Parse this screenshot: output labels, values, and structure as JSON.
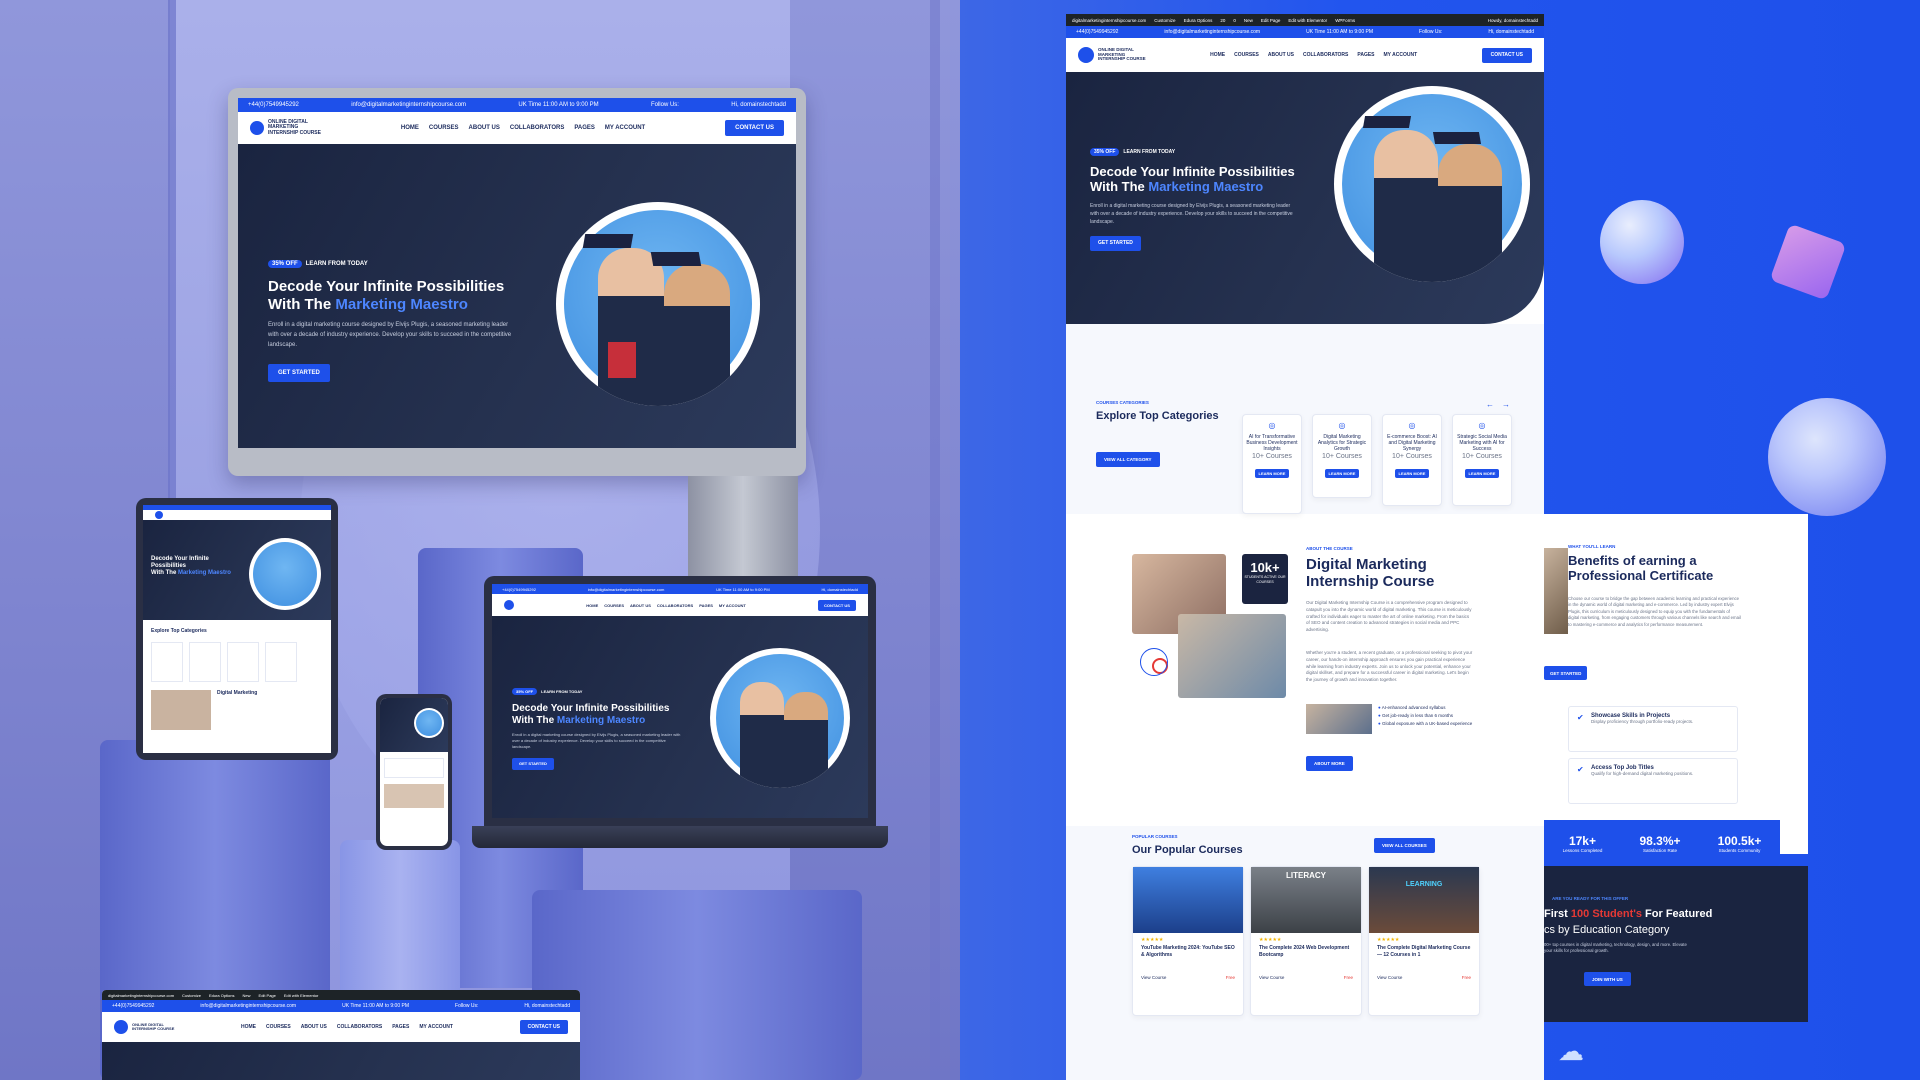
{
  "site": {
    "phone": "+44(0)7549945292",
    "email": "info@digitalmarketinginternshipcourse.com",
    "uk_time": "UK Time 11:00 AM to 9:00 PM",
    "follow_us": "Follow Us:",
    "greeting": "Hi, domainstechtadd",
    "logo_line1": "ONLINE DIGITAL",
    "logo_line2": "MARKETING",
    "logo_line3": "INTERNSHIP COURSE",
    "nav": [
      "HOME",
      "COURSES",
      "ABOUT US",
      "COLLABORATORS",
      "PAGES",
      "MY ACCOUNT"
    ],
    "contact_btn": "CONTACT US",
    "admin_bar": [
      "digitalmarketinginternshipcourse.com",
      "Customize",
      "Edura Options",
      "20",
      "0",
      "New",
      "Edit Page",
      "Edit with Elementor",
      "WPForms"
    ],
    "admin_howdy": "Howdy, domainstechtadd"
  },
  "hero": {
    "badge_off": "35% OFF",
    "badge_text": "LEARN FROM TODAY",
    "title_line1": "Decode Your Infinite Possibilities",
    "title_line2_plain": "With The ",
    "title_line2_accent": "Marketing Maestro",
    "desc": "Enroll in a digital marketing course designed by Elvijs Plugis, a seasoned marketing leader with over a decade of industry experience. Develop your skills to succeed in the competitive landscape.",
    "cta": "GET STARTED"
  },
  "categories": {
    "eyebrow": "COURSES CATEGORIES",
    "title": "Explore Top Categories",
    "view_all": "VIEW ALL CATEGORY",
    "items": [
      {
        "name": "AI for Transformative Business Development Insights",
        "count": "10+ Courses",
        "btn": "LEARN MORE"
      },
      {
        "name": "Digital Marketing Analytics for Strategic Growth",
        "count": "10+ Courses",
        "btn": "LEARN MORE"
      },
      {
        "name": "E-commerce Boost: AI and Digital Marketing Synergy",
        "count": "10+ Courses",
        "btn": "LEARN MORE"
      },
      {
        "name": "Strategic Social Media Marketing with AI for Success",
        "count": "10+ Courses",
        "btn": "LEARN MORE"
      }
    ]
  },
  "about": {
    "eyebrow": "ABOUT THE COURSE",
    "title_line1": "Digital Marketing",
    "title_line2": "Internship Course",
    "stat_num": "10k+",
    "stat_label": "STUDENTS ACTIVE OUR COURSES",
    "para1": "Our Digital Marketing Internship Course is a comprehensive program designed to catapult you into the dynamic world of digital marketing. This course is meticulously crafted for individuals eager to master the art of online marketing. From the basics of SEO and content creation to advanced strategies in social media and PPC advertising.",
    "para2": "Whether you're a student, a recent graduate, or a professional seeking to pivot your career, our hands-on internship approach ensures you gain practical experience while learning from industry experts. Join us to unlock your potential, enhance your digital skillset, and prepare for a successful career in digital marketing. Let's begin the journey of growth and innovation together.",
    "bullets": [
      "AI-enhanced advanced syllabus",
      "Get job-ready in less than 6 months",
      "Global exposure with a UK-based experience"
    ],
    "btn": "ABOUT MORE"
  },
  "benefits": {
    "eyebrow": "WHAT YOU'LL LEARN",
    "title_line1": "Benefits of earning a",
    "title_line2": "Professional Certificate",
    "desc": "Choose our course to bridge the gap between academic learning and practical experience in the dynamic world of digital marketing and e-commerce. Led by industry expert Elvijs Plugis, this curriculum is meticulously designed to equip you with the fundamentals of digital marketing, from engaging customers through various channels like search and email to mastering e-commerce and analytics for performance measurement.",
    "items": [
      {
        "title": "Showcase Skills in Projects",
        "desc": "Display proficiency through portfolio-ready projects."
      },
      {
        "title": "Access Top Job Titles",
        "desc": "Qualify for high-demand digital marketing positions."
      }
    ],
    "partial_btn": "GET STARTED"
  },
  "stats": [
    {
      "num": "17k+",
      "label": "Lessons Completed"
    },
    {
      "num": "98.3%+",
      "label": "Satisfaction Rate"
    },
    {
      "num": "100.5k+",
      "label": "Students Community"
    }
  ],
  "popular": {
    "eyebrow": "POPULAR COURSES",
    "title": "Our Popular Courses",
    "view_all": "VIEW ALL COURSES",
    "courses": [
      {
        "title": "YouTube Marketing 2024: YouTube SEO & Algorithms",
        "link": "View Course",
        "price": "Free",
        "img_label": ""
      },
      {
        "title": "The Complete 2024 Web Development Bootcamp",
        "link": "View Course",
        "price": "Free",
        "img_label": "LITERACY"
      },
      {
        "title": "The Complete Digital Marketing Course — 12 Courses in 1",
        "link": "View Course",
        "price": "Free",
        "img_label": "LEARNING"
      }
    ]
  },
  "cta_dark": {
    "eyebrow": "ARE YOU READY FOR THIS OFFER",
    "title_pre": "First ",
    "title_accent": "100 Student's",
    "title_post": " For Featured",
    "subtitle": "cs by Education Category",
    "desc": "00+ top courses in digital marketing, technology, design, and more. Elevate your skills for professional growth.",
    "btn": "JOIN WITH US"
  },
  "colors": {
    "brand": "#1e50ea",
    "dark": "#1a2440",
    "accent_red": "#e53935"
  }
}
